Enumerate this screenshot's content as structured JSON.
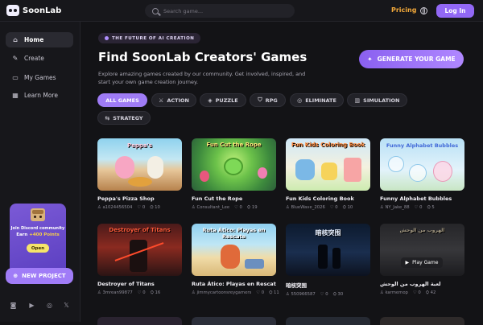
{
  "app": {
    "name": "SoonLab"
  },
  "header": {
    "search_placeholder": "Search game...",
    "pricing": "Pricing",
    "login": "Log In"
  },
  "sidebar": {
    "items": [
      {
        "label": "Home",
        "icon": "home-icon"
      },
      {
        "label": "Create",
        "icon": "wand-icon"
      },
      {
        "label": "My Games",
        "icon": "gamepad-icon"
      },
      {
        "label": "Learn More",
        "icon": "grid-icon"
      }
    ],
    "promo": {
      "line1": "Join Discord community",
      "line2_prefix": "Earn ",
      "line2_points": "+400 Points",
      "open": "Open"
    },
    "new_project": "NEW PROJECT",
    "social": [
      "discord-icon",
      "youtube-icon",
      "instagram-icon",
      "x-icon"
    ]
  },
  "hero": {
    "tagline": "THE FUTURE OF AI CREATION",
    "title": "Find SoonLab Creators' Games",
    "subtitle": "Explore amazing games created by our community. Get involved, inspired, and start your own game creation journey.",
    "generate": "GENERATE YOUR GAME"
  },
  "filters": [
    {
      "label": "ALL GAMES",
      "icon": ""
    },
    {
      "label": "ACTION",
      "icon": "sword-icon"
    },
    {
      "label": "PUZZLE",
      "icon": "puzzle-icon"
    },
    {
      "label": "RPG",
      "icon": "shield-icon"
    },
    {
      "label": "ELIMINATE",
      "icon": "target-icon"
    },
    {
      "label": "SIMULATION",
      "icon": "chart-icon"
    },
    {
      "label": "STRATEGY",
      "icon": "strategy-icon"
    }
  ],
  "games": [
    {
      "title": "Peppa's Pizza Shop",
      "author": "a1024456504",
      "likes": "0",
      "plays": "10",
      "caption": "Peppa's"
    },
    {
      "title": "Fun Cut the Rope",
      "author": "Consultant_Lee",
      "likes": "0",
      "plays": "19",
      "caption": "Fun Cut the Rope"
    },
    {
      "title": "Fun Kids Coloring Book",
      "author": "BlueWave_2026",
      "likes": "0",
      "plays": "10",
      "caption": "Fun Kids Coloring Book"
    },
    {
      "title": "Funny Alphabet Bubbles",
      "author": "NY_Jake_88",
      "likes": "0",
      "plays": "5",
      "caption": "Funny Alphabet Bubbles"
    },
    {
      "title": "Destroyer of Titans",
      "author": "3mrean99877",
      "likes": "0",
      "plays": "16",
      "caption": "Destroyer of Titans"
    },
    {
      "title": "Ruta Ático: Playas en Rescate",
      "author": "jimmycartoonsreygamers",
      "likes": "0",
      "plays": "11",
      "caption": "Ruta Ático: Playas en Rescate"
    },
    {
      "title": "暗核突围",
      "author": "550966587",
      "likes": "0",
      "plays": "30",
      "caption": "暗核突围"
    },
    {
      "title": "لعبة الهروب من الوحش",
      "author": "karmemop",
      "likes": "0",
      "plays": "42",
      "caption": "الهروب من الوحش",
      "play": "Play Game"
    }
  ],
  "colors": {
    "accent": "#9f7cf6",
    "pricing": "#f3a93a",
    "background": "#131316"
  }
}
